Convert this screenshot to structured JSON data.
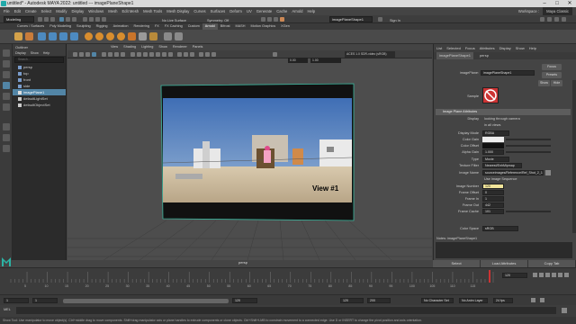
{
  "window": {
    "title": "untitled* - Autodesk MAYA 2022: untitled --- imagePlaneShape1"
  },
  "menubar": {
    "items": [
      "File",
      "Edit",
      "Create",
      "Select",
      "Modify",
      "Display",
      "Windows",
      "Mesh",
      "Edit Mesh",
      "Mesh Tools",
      "Mesh Display",
      "Curves",
      "Surfaces",
      "Deform",
      "UV",
      "Generate",
      "Cache",
      "Arnold",
      "Help"
    ],
    "workspace_label": "Workspace :",
    "workspace_value": "Maya Classic"
  },
  "status": {
    "mode": "Modeling",
    "surface": "No Live Surface",
    "symmetry": "Symmetry: Off",
    "object_field": "imagePlaneShape1",
    "login": "Sign In"
  },
  "shelf": {
    "tabs": [
      "Curves / Surfaces",
      "Poly Modeling",
      "Sculpting",
      "Rigging",
      "Animation",
      "Rendering",
      "FX",
      "FX Caching",
      "Custom",
      "Arnold",
      "Bifrost",
      "MASH",
      "Motion Graphics",
      "XGen"
    ],
    "active_tab": "Arnold"
  },
  "outliner": {
    "title": "Outliner",
    "menu": [
      "Display",
      "Show",
      "Help"
    ],
    "search_placeholder": "Search...",
    "items": [
      {
        "label": "persp"
      },
      {
        "label": "top"
      },
      {
        "label": "front"
      },
      {
        "label": "side"
      },
      {
        "label": "imagePlane1",
        "selected": true
      },
      {
        "label": "defaultLightSet"
      },
      {
        "label": "defaultObjectSet"
      }
    ]
  },
  "viewport": {
    "menu": [
      "View",
      "Shading",
      "Lighting",
      "Show",
      "Renderer",
      "Panels"
    ],
    "value1": "0.00",
    "value2": "1.00",
    "colorspace": "ACES 1.0 SDR-video (sRGB)",
    "camera_label": "persp",
    "image_overlay": "View #1"
  },
  "attribute_editor": {
    "tabs": [
      "List",
      "Selected",
      "Focus",
      "Attributes",
      "Display",
      "Show",
      "Help"
    ],
    "node_tabs": [
      "imagePlaneShape1",
      "persp"
    ],
    "node_label": "imagePlane:",
    "node_value": "imagePlaneShape1",
    "focus_btn": "Focus",
    "presets_btn": "Presets",
    "show_btn": "Show",
    "hide_btn": "Hide",
    "sample_label": "Sample",
    "section_title": "Image Plane Attributes",
    "display_label": "Display",
    "display_opt1": "looking through camera",
    "display_opt2": "in all views",
    "display_mode_label": "Display Mode",
    "display_mode_value": "RGBA",
    "color_gain_label": "Color Gain",
    "color_offset_label": "Color Offset",
    "alpha_gain_label": "Alpha Gain",
    "alpha_gain_value": "1.000",
    "type_label": "Type",
    "type_value": "Movie",
    "texture_filter_label": "Texture Filter",
    "texture_filter_value": "Nearest/EnhMipmap",
    "image_name_label": "Image Name",
    "image_name_value": "sourceimages/Reference/Ref_Shot_2_1.mov",
    "use_sequence_label": "Use Image Sequence",
    "image_number_label": "Image Number",
    "image_number_value": "120",
    "frame_offset_label": "Frame Offset",
    "frame_offset_value": "0",
    "frame_in_label": "Frame In",
    "frame_in_value": "1",
    "frame_out_label": "Frame Out",
    "frame_out_value": "442",
    "frame_cache_label": "Frame Cache",
    "frame_cache_value": "101",
    "color_space_label": "Color Space",
    "color_space_value": "sRGB",
    "notes_label": "Notes: imagePlaneShape1",
    "bottom_buttons": [
      "Select",
      "Load Attributes",
      "Copy Tab"
    ]
  },
  "timeline": {
    "ticks": [
      "5",
      "10",
      "15",
      "20",
      "25",
      "30",
      "35",
      "40",
      "45",
      "50",
      "55",
      "60",
      "65",
      "70",
      "75",
      "80",
      "85",
      "90",
      "95",
      "100",
      "105",
      "110",
      "115"
    ],
    "current_frame": "120"
  },
  "range": {
    "start": "1",
    "inner_start": "1",
    "inner_end": "120",
    "end_field": "120",
    "end_field2": "200",
    "character_set": "No Character Set",
    "anim_layer": "No Anim Layer",
    "fps": "24 fps"
  },
  "command": {
    "lang": "MEL"
  },
  "help": {
    "text": "Show Tool: Use manipulator to move object(s). Ctrl+middle drag to move components. Shift+drag manipulator axis or plane handles to extrude components or clone objects. Ctrl+Shift+LMB to constrain movement to a connected edge. Use D or INSERT to change the pivot position and axis orientation."
  }
}
